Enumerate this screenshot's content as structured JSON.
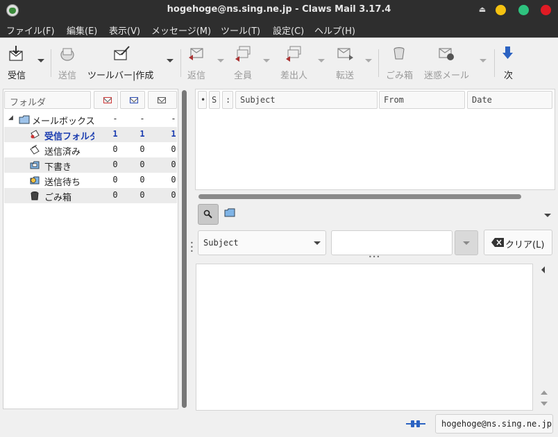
{
  "window": {
    "title": "hogehoge@ns.sing.ne.jp - Claws Mail 3.17.4"
  },
  "menubar": [
    "ファイル(F)",
    "編集(E)",
    "表示(V)",
    "メッセージ(M)",
    "ツール(T)",
    "設定(C)",
    "ヘルプ(H)"
  ],
  "toolbar": {
    "receive": "受信",
    "send": "送信",
    "compose": "ツールバー|作成",
    "reply": "返信",
    "reply_all": "全員",
    "reply_sender": "差出人",
    "forward": "転送",
    "trash": "ごみ箱",
    "spam": "迷惑メール",
    "next": "次"
  },
  "folderpane": {
    "header": "フォルダ",
    "rows": [
      {
        "name": "メールボックス",
        "new": "-",
        "unread": "-",
        "total": "-"
      },
      {
        "name": "受信フォルダ",
        "new": "1",
        "unread": "1",
        "total": "1"
      },
      {
        "name": "送信済み",
        "new": "0",
        "unread": "0",
        "total": "0"
      },
      {
        "name": "下書き",
        "new": "0",
        "unread": "0",
        "total": "0"
      },
      {
        "name": "送信待ち",
        "new": "0",
        "unread": "0",
        "total": "0"
      },
      {
        "name": "ごみ箱",
        "new": "0",
        "unread": "0",
        "total": "0"
      }
    ]
  },
  "msglist": {
    "columns": {
      "mark": "•",
      "status": "S",
      "attach": ":",
      "subject": "Subject",
      "from": "From",
      "date": "Date"
    }
  },
  "quicksearch": {
    "field": "Subject",
    "value": "",
    "clear_label": "クリア(L)"
  },
  "statusbar": {
    "account": "hogehoge@ns.sing.ne.jp"
  },
  "colors": {
    "titlebar": "#2e2e2e",
    "unread_bold": "#1a3cb0",
    "minimize": "#f5c211",
    "maximize": "#2ec27e",
    "close": "#e01b24"
  }
}
